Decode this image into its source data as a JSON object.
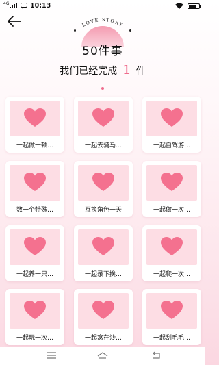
{
  "statusbar": {
    "network": "4G",
    "time": "10:13"
  },
  "header": {
    "badge_text": "LOVE STORY",
    "title": "50件事",
    "done_prefix": "我们已经完成",
    "done_count": "1",
    "done_suffix": "件"
  },
  "colors": {
    "accent": "#ef6c8d",
    "heart": "#f4718f",
    "card_bg": "#fddde4"
  },
  "items": [
    {
      "label": "一起做一顿…"
    },
    {
      "label": "一起去骑马…"
    },
    {
      "label": "一起自驾游…"
    },
    {
      "label": "数一个特殊…"
    },
    {
      "label": "互换角色一天"
    },
    {
      "label": "一起做一次…"
    },
    {
      "label": "一起养一只…"
    },
    {
      "label": "一起录下挨…"
    },
    {
      "label": "一起爬一次…"
    },
    {
      "label": "一起玩一次…"
    },
    {
      "label": "一起窝在沙…"
    },
    {
      "label": "一起刮毛毛…"
    }
  ],
  "navbar": {
    "icons": [
      "menu-icon",
      "home-icon",
      "back-icon"
    ]
  }
}
